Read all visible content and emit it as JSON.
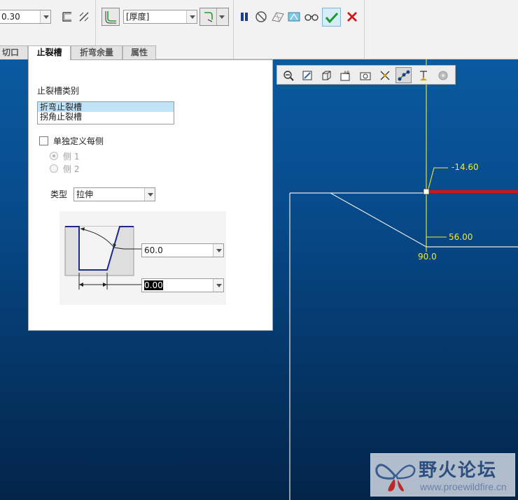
{
  "dashboard": {
    "thickness_value": "0.30",
    "side_combo_value": "[厚度]",
    "icons": {
      "sheet_edge": "sheet-edge-icon",
      "flip": "flip-direction-icon",
      "bend_type": "bend-corner-icon",
      "pause": "pause-icon",
      "no_preview": "no-preview-icon",
      "preview_wire": "preview-wireframe-icon",
      "preview_shade": "preview-shaded-icon",
      "glasses": "glasses-icon",
      "accept": "check-icon",
      "cancel": "close-icon"
    },
    "colors": {
      "accept": "#1a9a2a",
      "cancel": "#cc1a1a",
      "pause": "#1c3d8c"
    }
  },
  "tabs": [
    {
      "label": "切口",
      "active": false
    },
    {
      "label": "止裂槽",
      "active": true
    },
    {
      "label": "折弯余量",
      "active": false
    },
    {
      "label": "属性",
      "active": false
    }
  ],
  "panel": {
    "relief_category_label": "止裂槽类别",
    "relief_list": [
      "折弯止裂槽",
      "拐角止裂槽"
    ],
    "selected_index": 0,
    "define_each_side_label": "单独定义每侧",
    "define_each_side_checked": false,
    "side1_label": "侧 1",
    "side2_label": "侧 2",
    "type_label": "类型",
    "type_value": "拉伸",
    "angle_value": "60.0",
    "width_value": "0.00"
  },
  "view_toolbar": {
    "icons": [
      "zoom-out-icon",
      "refit-icon",
      "repaint-icon",
      "orient-icon",
      "named-views-icon",
      "spin-center-icon",
      "datum-display-icon",
      "annotation-display-icon",
      "appearance-icon",
      "render-icon"
    ],
    "active_index": 6
  },
  "viewport": {
    "dim_a": "-14.60",
    "dim_b": "56.00",
    "dim_c": "90.0",
    "colors": {
      "dimension": "#f0e840",
      "edge": "#e8e8e8",
      "selected_edge": "#d01818",
      "background_top": "#0a5aa0",
      "background_bottom": "#03244a"
    }
  },
  "watermark": {
    "title": "野火论坛",
    "url": "www.proewildfire.cn"
  }
}
